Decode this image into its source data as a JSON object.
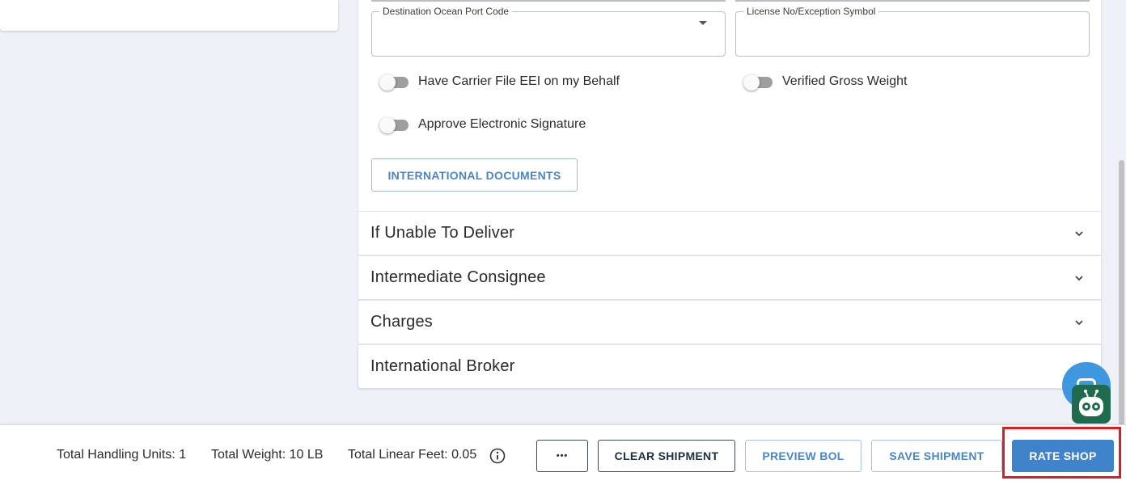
{
  "form": {
    "destination_port": {
      "label": "Destination Ocean Port Code",
      "value": ""
    },
    "license_no": {
      "label": "License No/Exception Symbol",
      "value": ""
    },
    "toggles": {
      "carrier_file_eei": "Have Carrier File EEI on my Behalf",
      "verified_gross_weight": "Verified Gross Weight",
      "approve_signature": "Approve Electronic Signature"
    },
    "intl_docs_button": "INTERNATIONAL DOCUMENTS"
  },
  "accordion": [
    {
      "title": "If Unable To Deliver"
    },
    {
      "title": "Intermediate Consignee"
    },
    {
      "title": "Charges"
    },
    {
      "title": "International Broker"
    }
  ],
  "footer": {
    "handling_units": "Total Handling Units: 1",
    "weight": "Total Weight: 10 LB",
    "linear_feet": "Total Linear Feet: 0.05",
    "more_label": "•••",
    "clear_label": "CLEAR SHIPMENT",
    "preview_label": "PREVIEW BOL",
    "save_label": "SAVE SHIPMENT",
    "rate_label": "RATE SHOP"
  },
  "colors": {
    "accent": "#3f84cb",
    "highlight": "#e01b22",
    "bot": "#1f6b4d"
  }
}
